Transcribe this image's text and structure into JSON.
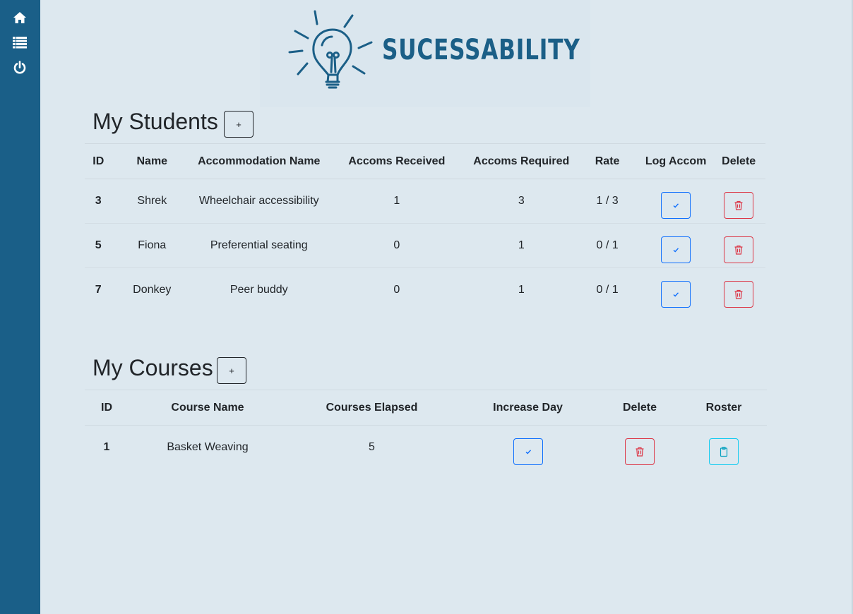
{
  "sidebar": {
    "items": [
      {
        "name": "home-icon"
      },
      {
        "name": "list-icon"
      },
      {
        "name": "power-icon"
      }
    ]
  },
  "logo": {
    "text": "SUCESSABILITY"
  },
  "students": {
    "title": "My Students",
    "add_label": "+",
    "headers": [
      "ID",
      "Name",
      "Accommodation Name",
      "Accoms Received",
      "Accoms Required",
      "Rate",
      "Log Accom",
      "Delete"
    ],
    "rows": [
      {
        "id": "3",
        "name": "Shrek",
        "accommodation": "Wheelchair accessibility",
        "received": "1",
        "required": "3",
        "rate": "1 / 3"
      },
      {
        "id": "5",
        "name": "Fiona",
        "accommodation": "Preferential seating",
        "received": "0",
        "required": "1",
        "rate": "0 / 1"
      },
      {
        "id": "7",
        "name": "Donkey",
        "accommodation": "Peer buddy",
        "received": "0",
        "required": "1",
        "rate": "0 / 1"
      }
    ]
  },
  "courses": {
    "title": "My Courses",
    "add_label": "+",
    "headers": [
      "ID",
      "Course Name",
      "Courses Elapsed",
      "Increase Day",
      "Delete",
      "Roster"
    ],
    "rows": [
      {
        "id": "1",
        "course_name": "Basket Weaving",
        "elapsed": "5"
      }
    ]
  },
  "colors": {
    "sidebar": "#1a5f88",
    "background": "#dde8ef",
    "primary": "#0d6efd",
    "danger": "#dc3545",
    "info": "#0dcaf0",
    "brand": "#1b5f87"
  }
}
